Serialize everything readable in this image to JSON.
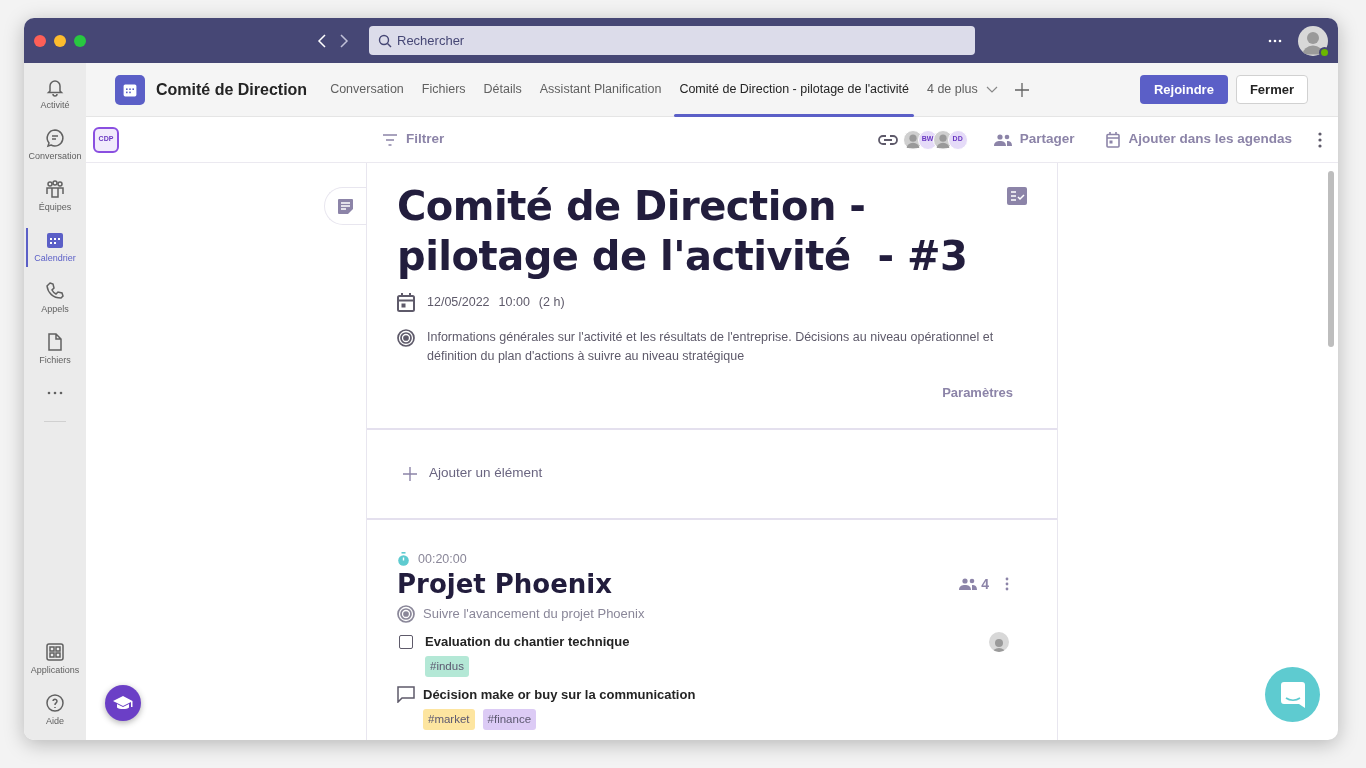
{
  "search": {
    "placeholder": "Rechercher"
  },
  "rail": [
    {
      "label": "Activité",
      "kind": "bell",
      "selected": false
    },
    {
      "label": "Conversation",
      "kind": "chat",
      "selected": false
    },
    {
      "label": "Équipes",
      "kind": "teams",
      "selected": false
    },
    {
      "label": "Calendrier",
      "kind": "calendar",
      "selected": true
    },
    {
      "label": "Appels",
      "kind": "phone",
      "selected": false
    },
    {
      "label": "Fichiers",
      "kind": "file",
      "selected": false
    }
  ],
  "rail_bottom": [
    {
      "label": "Applications",
      "kind": "apps"
    },
    {
      "label": "Aide",
      "kind": "help"
    }
  ],
  "header": {
    "title": "Comité de Direction",
    "tabs": [
      {
        "label": "Conversation",
        "selected": false
      },
      {
        "label": "Fichiers",
        "selected": false
      },
      {
        "label": "Détails",
        "selected": false
      },
      {
        "label": "Assistant Planification",
        "selected": false
      },
      {
        "label": "Comité de Direction - pilotage de l'activité",
        "selected": true
      }
    ],
    "more_tabs": "4 de plus",
    "buttons": [
      {
        "label": "Rejoindre",
        "kind": "primary"
      },
      {
        "label": "Fermer",
        "kind": "secondary"
      }
    ]
  },
  "toolbar": {
    "badge": "CDP",
    "filter": "Filtrer",
    "participants": [
      {
        "kind": "photo"
      },
      {
        "kind": "initials",
        "initials": "BW"
      },
      {
        "kind": "photo"
      },
      {
        "kind": "initials",
        "initials": "DD"
      }
    ],
    "share": "Partager",
    "calendar": "Ajouter dans les agendas"
  },
  "meeting": {
    "title": "Comité de Direction - pilotage de l'activité  - #3",
    "date": "12/05/2022",
    "time": "10:00",
    "duration": "(2 h)",
    "objective": "Informations générales sur l'activité et les résultats de l'entreprise. Décisions au niveau opérationnel et définition du plan d'actions à suivre au niveau stratégique",
    "settings": "Paramètres"
  },
  "add_item": "Ajouter un élément",
  "topics": [
    {
      "duration": "00:20:00",
      "title": "Projet Phoenix",
      "participants": "4",
      "objective": "Suivre l'avancement du projet Phoenix",
      "items": [
        {
          "kind": "task",
          "checked": false,
          "title": "Evaluation du chantier technique",
          "assigned": true,
          "tags": [
            {
              "label": "#indus",
              "color": "#b4e8d6"
            }
          ]
        },
        {
          "kind": "discussion",
          "title": "Décision make or buy sur la communication",
          "assigned": false,
          "tags": [
            {
              "label": "#market",
              "color": "#fde5a0"
            },
            {
              "label": "#finance",
              "color": "#dccbf5"
            }
          ]
        }
      ]
    }
  ]
}
